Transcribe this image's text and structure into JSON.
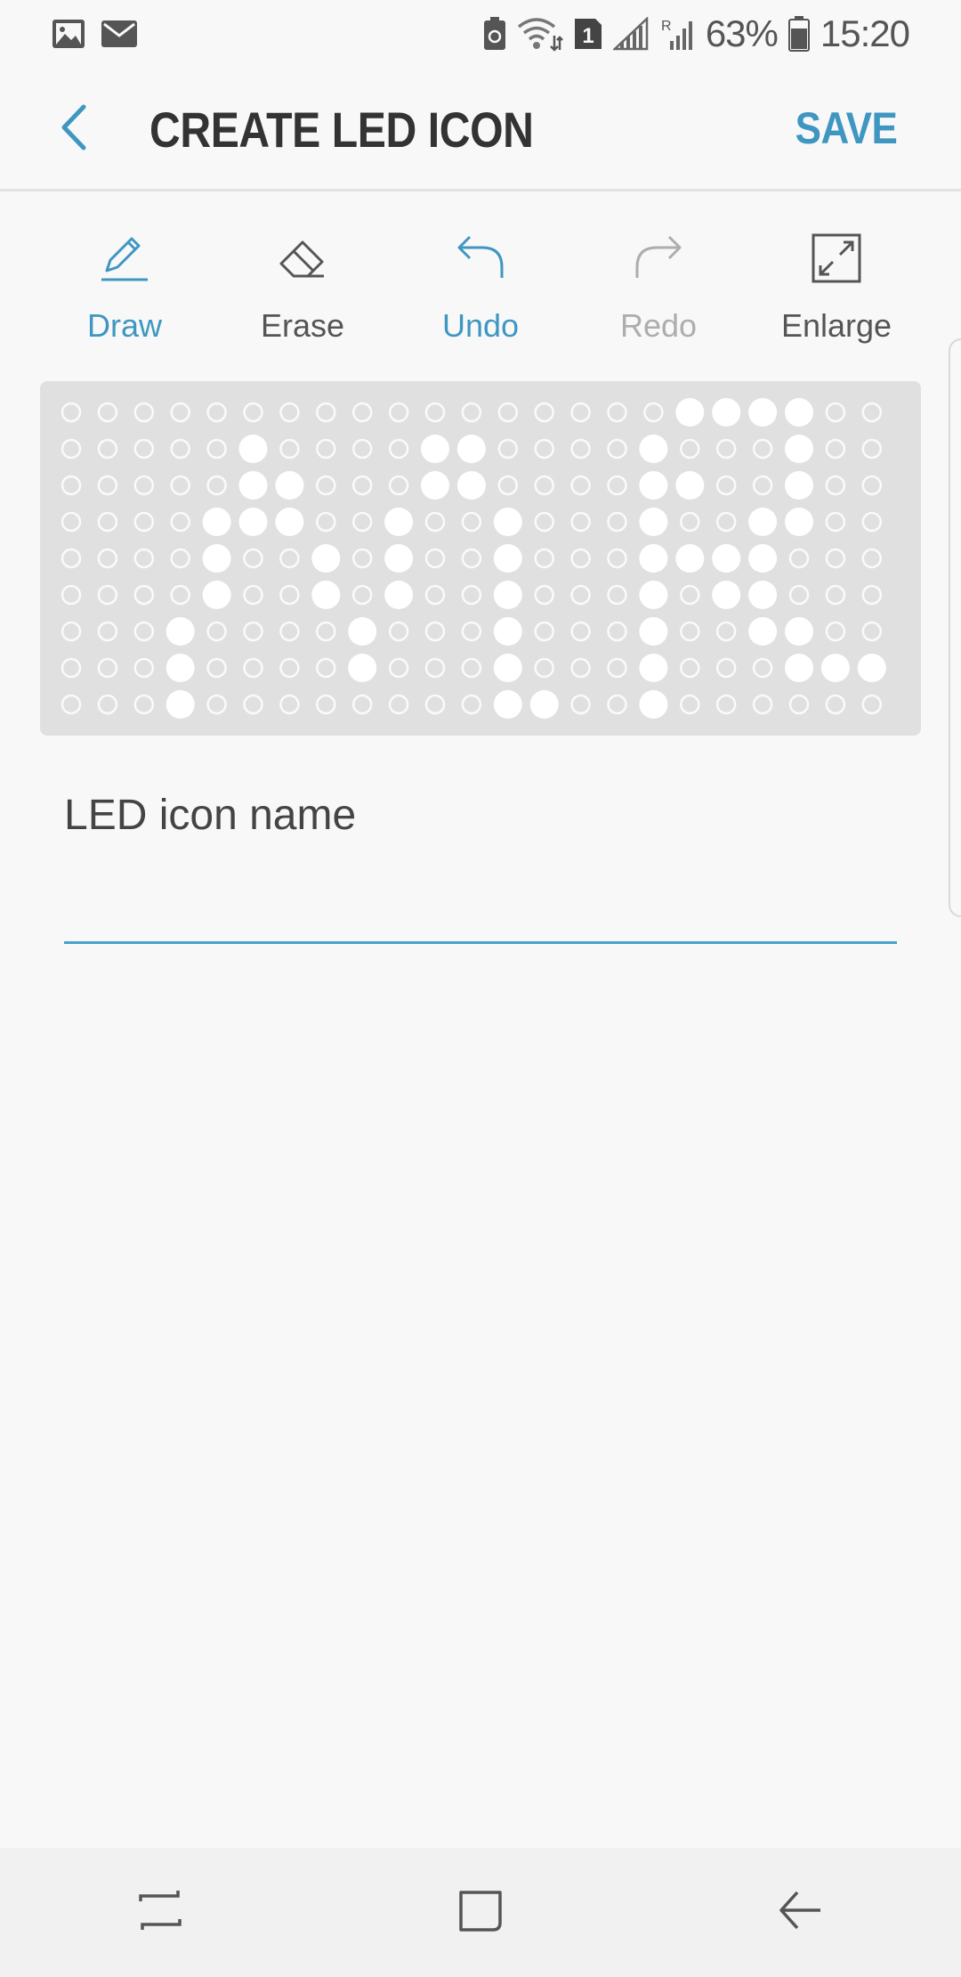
{
  "status_bar": {
    "battery_percent": "63%",
    "time": "15:20",
    "sim_number": "1",
    "roaming_letter": "R",
    "left_icons": [
      "gallery-icon",
      "email-icon"
    ],
    "right_icons": [
      "battery-saver-icon",
      "wifi-icon",
      "sim-icon",
      "signal-icon",
      "roaming-signal-icon",
      "battery-icon"
    ]
  },
  "app_bar": {
    "title": "CREATE LED ICON",
    "save_label": "SAVE",
    "back_icon": "chevron-left-icon"
  },
  "toolbar": {
    "tools": [
      {
        "label": "Draw",
        "icon": "pencil-icon",
        "state": "active"
      },
      {
        "label": "Erase",
        "icon": "eraser-icon",
        "state": "normal"
      },
      {
        "label": "Undo",
        "icon": "undo-icon",
        "state": "active"
      },
      {
        "label": "Redo",
        "icon": "redo-icon",
        "state": "disabled"
      },
      {
        "label": "Enlarge",
        "icon": "enlarge-icon",
        "state": "normal"
      }
    ]
  },
  "led_grid": {
    "columns": 23,
    "rows": 9,
    "on_cells": [
      [
        0,
        17
      ],
      [
        0,
        18
      ],
      [
        0,
        19
      ],
      [
        0,
        20
      ],
      [
        1,
        5
      ],
      [
        1,
        10
      ],
      [
        1,
        11
      ],
      [
        1,
        16
      ],
      [
        1,
        20
      ],
      [
        2,
        5
      ],
      [
        2,
        6
      ],
      [
        2,
        10
      ],
      [
        2,
        11
      ],
      [
        2,
        16
      ],
      [
        2,
        17
      ],
      [
        2,
        20
      ],
      [
        3,
        4
      ],
      [
        3,
        5
      ],
      [
        3,
        6
      ],
      [
        3,
        9
      ],
      [
        3,
        12
      ],
      [
        3,
        16
      ],
      [
        3,
        19
      ],
      [
        3,
        20
      ],
      [
        4,
        4
      ],
      [
        4,
        7
      ],
      [
        4,
        9
      ],
      [
        4,
        12
      ],
      [
        4,
        16
      ],
      [
        4,
        17
      ],
      [
        4,
        18
      ],
      [
        4,
        19
      ],
      [
        5,
        4
      ],
      [
        5,
        7
      ],
      [
        5,
        9
      ],
      [
        5,
        12
      ],
      [
        5,
        16
      ],
      [
        5,
        18
      ],
      [
        5,
        19
      ],
      [
        6,
        3
      ],
      [
        6,
        8
      ],
      [
        6,
        12
      ],
      [
        6,
        16
      ],
      [
        6,
        19
      ],
      [
        6,
        20
      ],
      [
        7,
        3
      ],
      [
        7,
        8
      ],
      [
        7,
        12
      ],
      [
        7,
        16
      ],
      [
        7,
        20
      ],
      [
        7,
        21
      ],
      [
        7,
        22
      ],
      [
        8,
        3
      ],
      [
        8,
        12
      ],
      [
        8,
        13
      ],
      [
        8,
        16
      ]
    ]
  },
  "name_field": {
    "label": "LED icon name",
    "value": ""
  },
  "nav_bar": {
    "buttons": [
      "recent-apps-icon",
      "home-icon",
      "back-icon"
    ]
  },
  "colors": {
    "accent": "#3f97c1",
    "disabled": "#adadad",
    "grid_bg": "#e0e0e0",
    "led_on": "#ffffff"
  }
}
